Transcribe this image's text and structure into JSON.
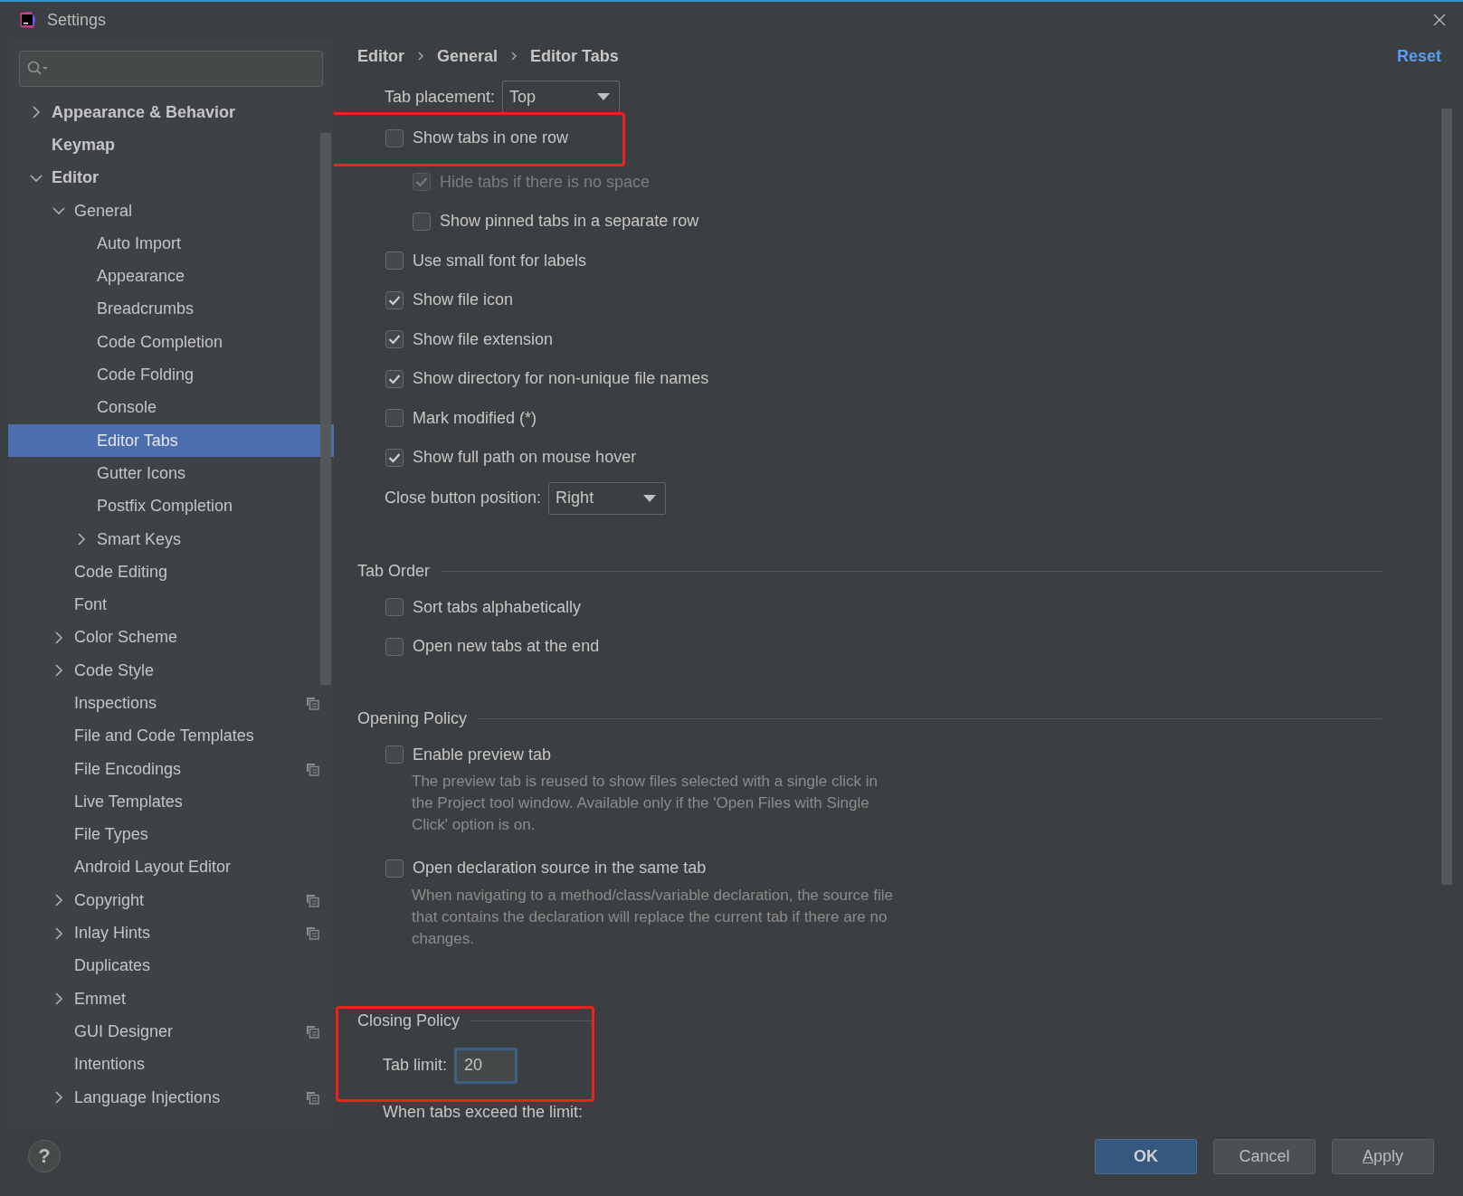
{
  "window": {
    "title": "Settings"
  },
  "sidebar": {
    "items": [
      {
        "label": "Appearance & Behavior",
        "kind": "folder",
        "expanded": false,
        "selected": false,
        "scope_icon": false
      },
      {
        "label": "Keymap",
        "kind": "page",
        "selected": false,
        "scope_icon": false
      },
      {
        "label": "Editor",
        "kind": "folder",
        "expanded": true,
        "selected": false,
        "scope_icon": false,
        "children": [
          {
            "label": "General",
            "kind": "folder",
            "expanded": true,
            "selected": false,
            "scope_icon": false,
            "children": [
              {
                "label": "Auto Import",
                "kind": "page",
                "selected": false,
                "scope_icon": false
              },
              {
                "label": "Appearance",
                "kind": "page",
                "selected": false,
                "scope_icon": false
              },
              {
                "label": "Breadcrumbs",
                "kind": "page",
                "selected": false,
                "scope_icon": false
              },
              {
                "label": "Code Completion",
                "kind": "page",
                "selected": false,
                "scope_icon": false
              },
              {
                "label": "Code Folding",
                "kind": "page",
                "selected": false,
                "scope_icon": false
              },
              {
                "label": "Console",
                "kind": "page",
                "selected": false,
                "scope_icon": false
              },
              {
                "label": "Editor Tabs",
                "kind": "page",
                "selected": true,
                "scope_icon": false
              },
              {
                "label": "Gutter Icons",
                "kind": "page",
                "selected": false,
                "scope_icon": false
              },
              {
                "label": "Postfix Completion",
                "kind": "page",
                "selected": false,
                "scope_icon": false
              },
              {
                "label": "Smart Keys",
                "kind": "folder",
                "expanded": false,
                "selected": false,
                "scope_icon": false
              }
            ]
          },
          {
            "label": "Code Editing",
            "kind": "page",
            "selected": false,
            "scope_icon": false
          },
          {
            "label": "Font",
            "kind": "page",
            "selected": false,
            "scope_icon": false
          },
          {
            "label": "Color Scheme",
            "kind": "folder",
            "expanded": false,
            "selected": false,
            "scope_icon": false
          },
          {
            "label": "Code Style",
            "kind": "folder",
            "expanded": false,
            "selected": false,
            "scope_icon": false
          },
          {
            "label": "Inspections",
            "kind": "page",
            "selected": false,
            "scope_icon": true
          },
          {
            "label": "File and Code Templates",
            "kind": "page",
            "selected": false,
            "scope_icon": false
          },
          {
            "label": "File Encodings",
            "kind": "page",
            "selected": false,
            "scope_icon": true
          },
          {
            "label": "Live Templates",
            "kind": "page",
            "selected": false,
            "scope_icon": false
          },
          {
            "label": "File Types",
            "kind": "page",
            "selected": false,
            "scope_icon": false
          },
          {
            "label": "Android Layout Editor",
            "kind": "page",
            "selected": false,
            "scope_icon": false
          },
          {
            "label": "Copyright",
            "kind": "folder",
            "expanded": false,
            "selected": false,
            "scope_icon": true
          },
          {
            "label": "Inlay Hints",
            "kind": "folder",
            "expanded": false,
            "selected": false,
            "scope_icon": true
          },
          {
            "label": "Duplicates",
            "kind": "page",
            "selected": false,
            "scope_icon": false
          },
          {
            "label": "Emmet",
            "kind": "folder",
            "expanded": false,
            "selected": false,
            "scope_icon": false
          },
          {
            "label": "GUI Designer",
            "kind": "page",
            "selected": false,
            "scope_icon": true
          },
          {
            "label": "Intentions",
            "kind": "page",
            "selected": false,
            "scope_icon": false
          },
          {
            "label": "Language Injections",
            "kind": "folder",
            "expanded": false,
            "selected": false,
            "scope_icon": true
          }
        ]
      }
    ]
  },
  "panel": {
    "breadcrumb": [
      "Editor",
      "General",
      "Editor Tabs"
    ],
    "reset": "Reset",
    "groups": [
      {
        "highlighted": false,
        "items": [
          {
            "kind": "dropdown",
            "label": "Tab placement:",
            "value": "Top"
          },
          {
            "kind": "checkbox",
            "label": "Show tabs in one row",
            "checked": false,
            "disabled": false,
            "highlighted": true,
            "children": [
              {
                "kind": "checkbox",
                "label": "Hide tabs if there is no space",
                "checked": true,
                "disabled": true,
                "highlighted": false
              },
              {
                "kind": "checkbox",
                "label": "Show pinned tabs in a separate row",
                "checked": false,
                "disabled": false,
                "highlighted": false
              }
            ]
          },
          {
            "kind": "checkbox",
            "label": "Use small font for labels",
            "checked": false,
            "disabled": false,
            "highlighted": false
          },
          {
            "kind": "checkbox",
            "label": "Show file icon",
            "checked": true,
            "disabled": false,
            "highlighted": false
          },
          {
            "kind": "checkbox",
            "label": "Show file extension",
            "checked": true,
            "disabled": false,
            "highlighted": false
          },
          {
            "kind": "checkbox",
            "label": "Show directory for non-unique file names",
            "checked": true,
            "disabled": false,
            "highlighted": false
          },
          {
            "kind": "checkbox",
            "label": "Mark modified (*)",
            "checked": false,
            "disabled": false,
            "highlighted": false
          },
          {
            "kind": "checkbox",
            "label": "Show full path on mouse hover",
            "checked": true,
            "disabled": false,
            "highlighted": false
          },
          {
            "kind": "dropdown",
            "label": "Close button position:",
            "value": "Right"
          }
        ]
      },
      {
        "title": "Tab Order",
        "highlighted": false,
        "items": [
          {
            "kind": "checkbox",
            "label": "Sort tabs alphabetically",
            "checked": false,
            "disabled": false,
            "highlighted": false
          },
          {
            "kind": "checkbox",
            "label": "Open new tabs at the end",
            "checked": false,
            "disabled": false,
            "highlighted": false
          }
        ]
      },
      {
        "title": "Opening Policy",
        "highlighted": false,
        "items": [
          {
            "kind": "checkbox",
            "label": "Enable preview tab",
            "checked": false,
            "disabled": false,
            "highlighted": false,
            "description": "The preview tab is reused to show files selected with a single click in the Project tool window. Available only if the 'Open Files with Single Click' option is on."
          },
          {
            "kind": "checkbox",
            "label": "Open declaration source in the same tab",
            "checked": false,
            "disabled": false,
            "highlighted": false,
            "description": "When navigating to a method/class/variable declaration, the source file that contains the declaration will replace the current tab if there are no changes."
          }
        ]
      },
      {
        "title": "Closing Policy",
        "highlighted": true,
        "items": [
          {
            "kind": "field",
            "label": "Tab limit:",
            "value": "20"
          }
        ]
      },
      {
        "highlighted": false,
        "items": [
          {
            "kind": "text",
            "label": "When tabs exceed the limit:"
          }
        ]
      }
    ]
  },
  "footer": {
    "help": "?",
    "buttons": [
      {
        "label": "OK",
        "kind": "primary"
      },
      {
        "label": "Cancel",
        "kind": "normal"
      },
      {
        "label": "Apply",
        "kind": "normal"
      }
    ]
  }
}
